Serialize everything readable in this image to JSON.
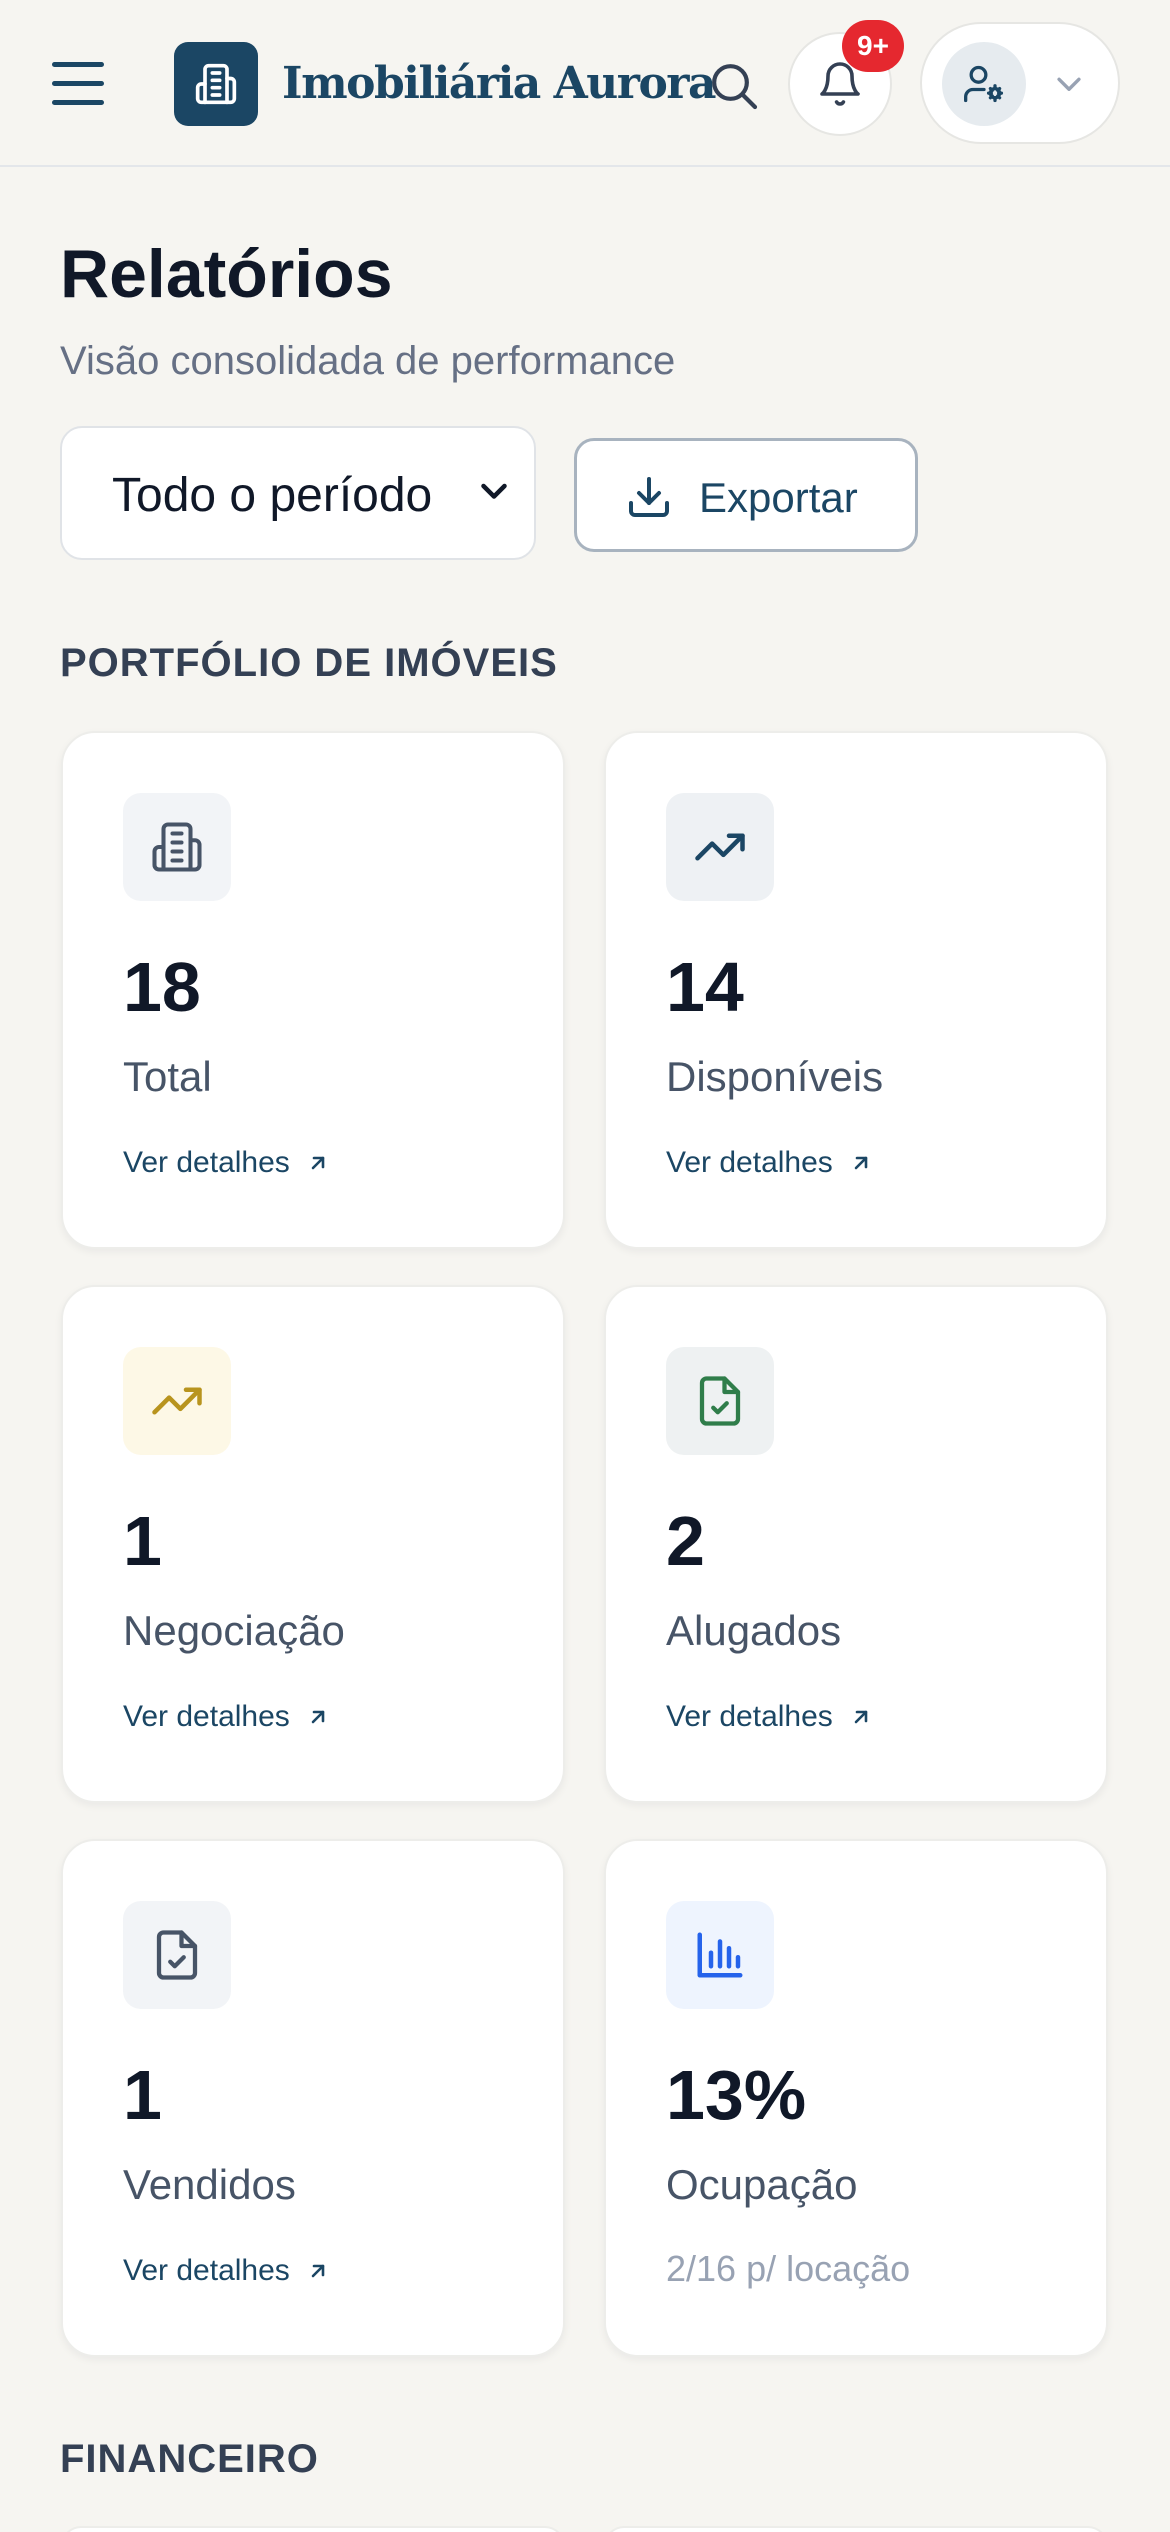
{
  "header": {
    "brand": "Imobiliária Aurora",
    "notification_badge": "9+"
  },
  "page": {
    "title": "Relatórios",
    "subtitle": "Visão consolidada de performance"
  },
  "controls": {
    "period_value": "Todo o período",
    "export_label": "Exportar"
  },
  "sections": {
    "portfolio": "PORTFÓLIO DE IMÓVEIS",
    "financial": "FINANCEIRO"
  },
  "cards": [
    {
      "value": "18",
      "label": "Total",
      "link": "Ver detalhes",
      "icon": "building-icon",
      "icon_bg": "#f2f4f7",
      "icon_color": "#475467"
    },
    {
      "value": "14",
      "label": "Disponíveis",
      "link": "Ver detalhes",
      "icon": "trending-up-icon",
      "icon_bg": "#eef1f4",
      "icon_color": "#1b4664"
    },
    {
      "value": "1",
      "label": "Negociação",
      "link": "Ver detalhes",
      "icon": "trending-up-icon",
      "icon_bg": "#fdf8e6",
      "icon_color": "#b8941e"
    },
    {
      "value": "2",
      "label": "Alugados",
      "link": "Ver detalhes",
      "icon": "file-check-icon",
      "icon_bg": "#eef1f2",
      "icon_color": "#2f7d4a"
    },
    {
      "value": "1",
      "label": "Vendidos",
      "link": "Ver detalhes",
      "icon": "file-check-icon",
      "icon_bg": "#f2f4f7",
      "icon_color": "#475467"
    },
    {
      "value": "13%",
      "label": "Ocupação",
      "sub": "2/16 p/ locação",
      "icon": "bar-chart-icon",
      "icon_bg": "#eef4fe",
      "icon_color": "#2563eb"
    }
  ],
  "colors": {
    "brand": "#1b4664",
    "background": "#f6f5f1",
    "badge": "#e5282f"
  }
}
